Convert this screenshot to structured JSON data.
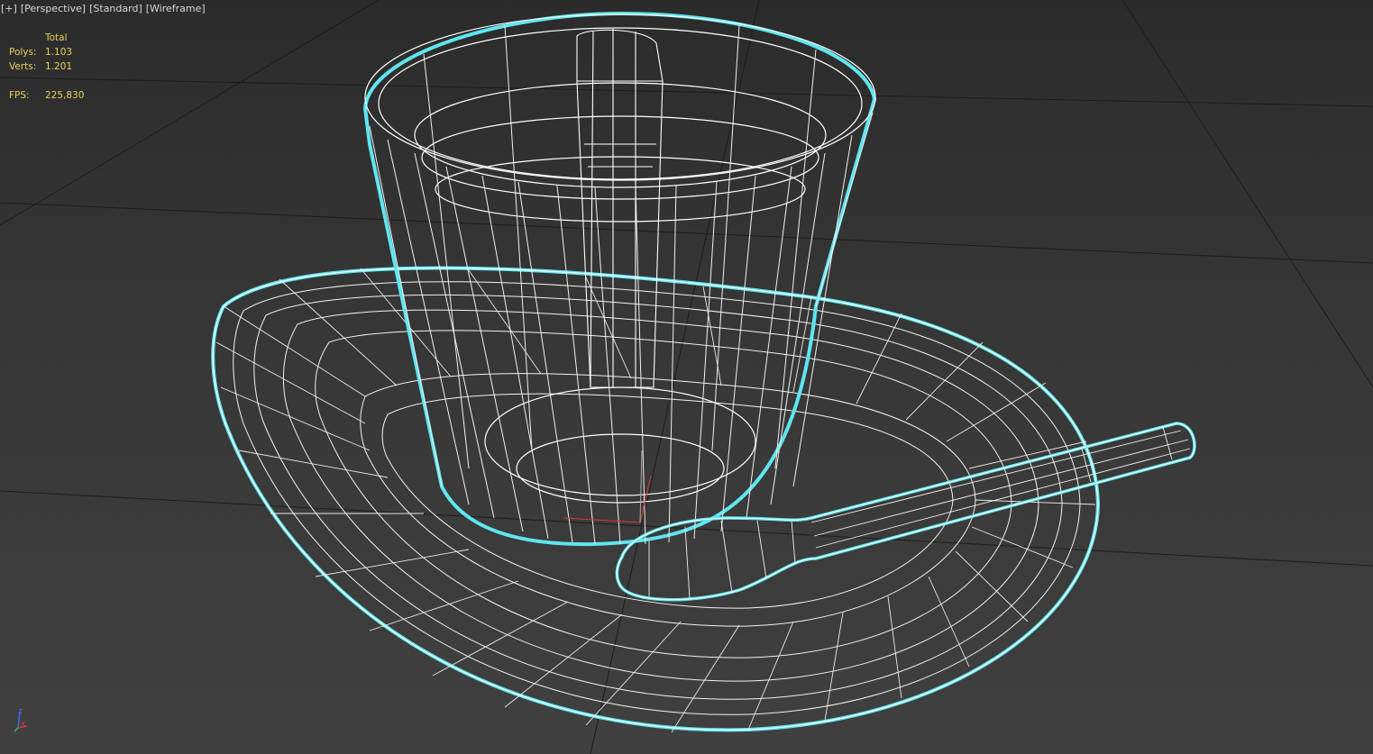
{
  "viewport": {
    "labels": [
      "[+]",
      "[Perspective]",
      "[Standard]",
      "[Wireframe]"
    ]
  },
  "stats": {
    "header": "Total",
    "polys_label": "Polys:",
    "polys_value": "1.103",
    "verts_label": "Verts:",
    "verts_value": "1.201",
    "fps_label": "FPS:",
    "fps_value": "225,830"
  },
  "axis_gizmo": {
    "z": "z",
    "x": "x"
  },
  "colors": {
    "wire": "#ffffff",
    "selection": "#5fe6f0",
    "grid": "#1e1e1e",
    "stats_text": "#e8d25a",
    "x_axis": "#d43a3a",
    "y_axis": "#38c43a",
    "z_axis": "#3c6cf0"
  }
}
